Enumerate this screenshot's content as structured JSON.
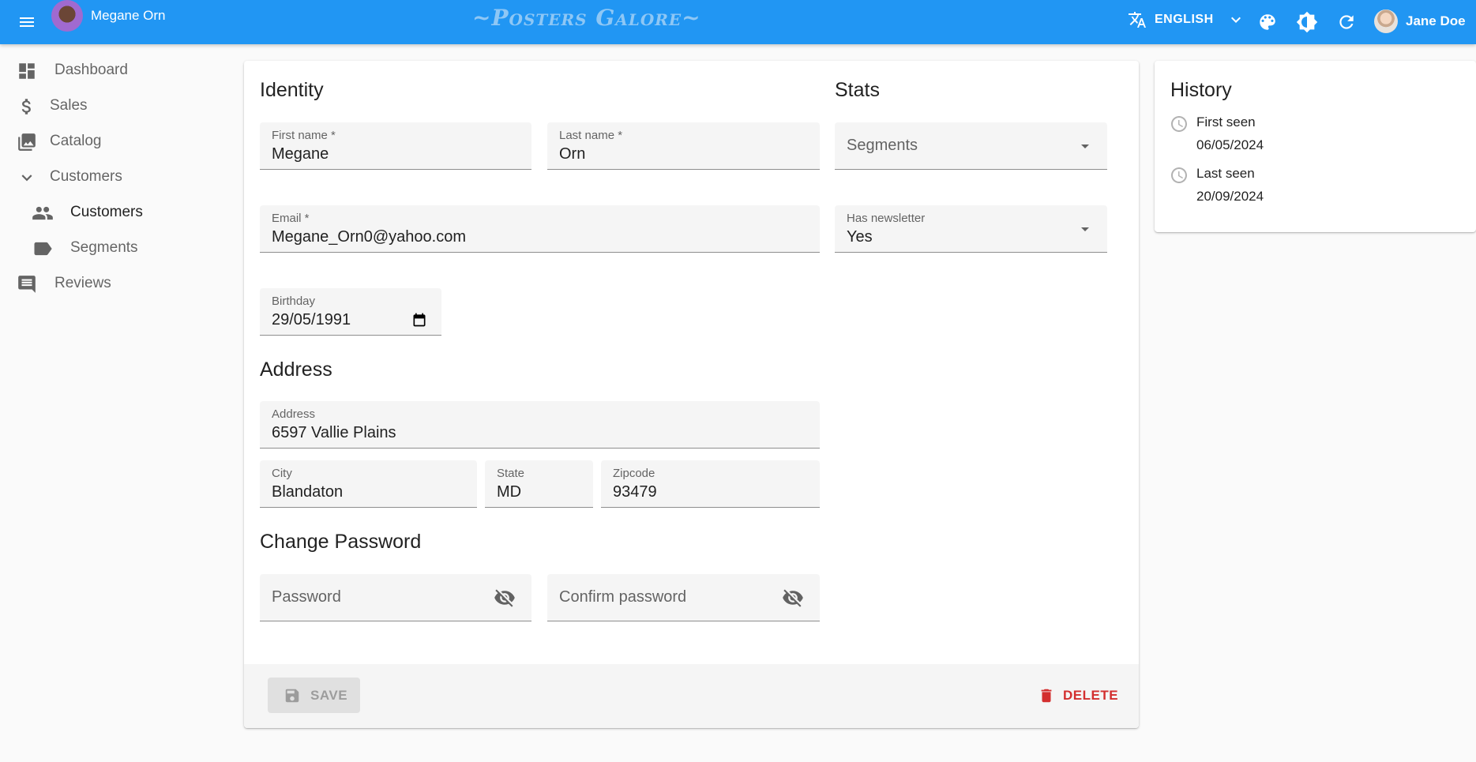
{
  "appbar": {
    "record_name": "Megane Orn",
    "brand": "~Posters Galore~",
    "language": "ENGLISH",
    "user_name": "Jane Doe",
    "color": "#2196f3"
  },
  "sidebar": {
    "items": [
      {
        "label": "Dashboard",
        "icon": "dashboard-icon"
      },
      {
        "label": "Sales",
        "icon": "dollar-icon"
      },
      {
        "label": "Catalog",
        "icon": "image-icon"
      },
      {
        "label": "Customers",
        "icon": "chevron-down-icon"
      },
      {
        "label": "Customers",
        "icon": "people-icon"
      },
      {
        "label": "Segments",
        "icon": "label-icon"
      },
      {
        "label": "Reviews",
        "icon": "comment-icon"
      }
    ]
  },
  "form": {
    "identity_title": "Identity",
    "first_name": {
      "label": "First name *",
      "value": "Megane"
    },
    "last_name": {
      "label": "Last name *",
      "value": "Orn"
    },
    "email": {
      "label": "Email *",
      "value": "Megane_Orn0@yahoo.com"
    },
    "birthday": {
      "label": "Birthday",
      "value": "29/05/1991"
    },
    "address_title": "Address",
    "address": {
      "label": "Address",
      "value": "6597 Vallie Plains"
    },
    "city": {
      "label": "City",
      "value": "Blandaton"
    },
    "state": {
      "label": "State",
      "value": "MD"
    },
    "zipcode": {
      "label": "Zipcode",
      "value": "93479"
    },
    "password_title": "Change Password",
    "password": {
      "placeholder": "Password"
    },
    "confirm_password": {
      "placeholder": "Confirm password"
    },
    "stats_title": "Stats",
    "segments": {
      "placeholder": "Segments"
    },
    "newsletter": {
      "label": "Has newsletter",
      "value": "Yes"
    },
    "save_label": "SAVE",
    "delete_label": "DELETE",
    "delete_color": "#d32f2f"
  },
  "history": {
    "title": "History",
    "first_seen_label": "First seen",
    "first_seen_value": "06/05/2024",
    "last_seen_label": "Last seen",
    "last_seen_value": "20/09/2024"
  }
}
